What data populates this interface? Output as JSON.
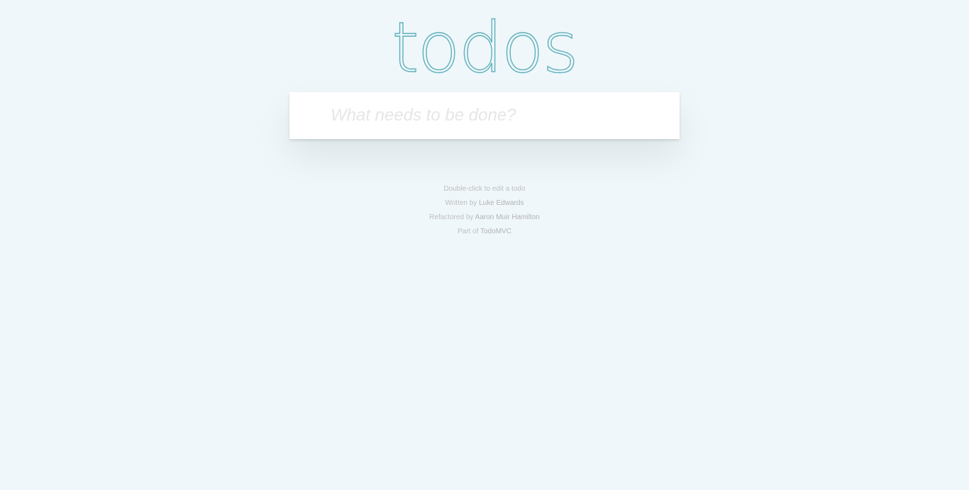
{
  "header": {
    "title": "todos"
  },
  "new_todo": {
    "placeholder": "What needs to be done?",
    "value": ""
  },
  "footer": {
    "hint": "Double-click to edit a todo",
    "written_prefix": "Written by",
    "written_author": "Luke Edwards",
    "refactored_prefix": "Refactored by",
    "refactored_author": "Aaron Muir Hamilton",
    "part_prefix": "Part of",
    "part_link": "TodoMVC"
  },
  "colors": {
    "background": "#eff7fa",
    "title": "#5fb0bb",
    "card": "#ffffff",
    "footer_text": "#bfbfbf"
  }
}
